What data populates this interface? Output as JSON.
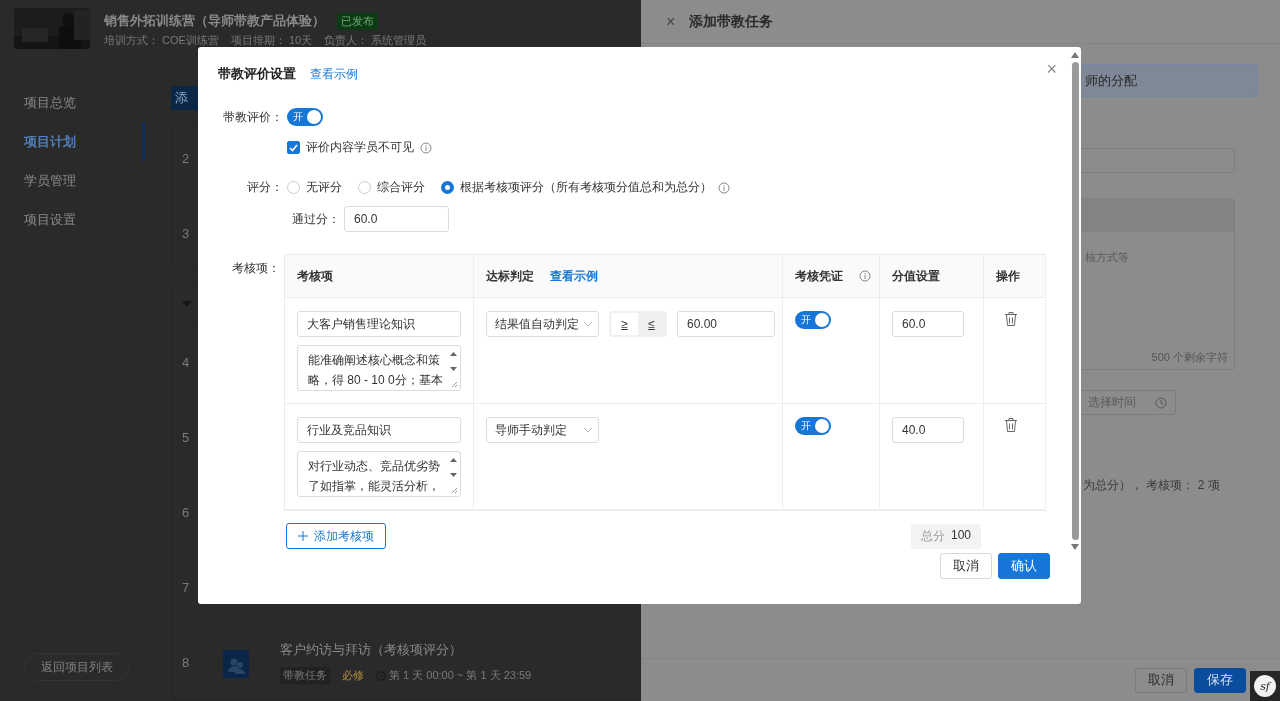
{
  "project": {
    "title": "销售外拓训练营（导师带教产品体验）",
    "status": "已发布",
    "meta": [
      {
        "label": "培训方式：",
        "value": "COE训练营"
      },
      {
        "label": "项目排期：",
        "value": "10天"
      },
      {
        "label": "负责人：",
        "value": "系统管理员"
      }
    ]
  },
  "sidebar": {
    "items": [
      {
        "label": "项目总览",
        "selected": false
      },
      {
        "label": "项目计划",
        "selected": true
      },
      {
        "label": "学员管理",
        "selected": false
      },
      {
        "label": "项目设置",
        "selected": false
      }
    ],
    "back_button": "返回项目列表"
  },
  "plan": {
    "add_button": "添",
    "first_group": [
      "2",
      "3"
    ],
    "second_group": {
      "expanded": true,
      "rows": [
        {
          "index": "4"
        },
        {
          "index": "5"
        },
        {
          "index": "6"
        },
        {
          "index": "7"
        },
        {
          "index": "8",
          "title": "客户约访与拜访（考核项评分）",
          "tag": "带教任务",
          "required": "必修",
          "time": "第 1 天 00:00 ~ 第 1 天 23:59"
        }
      ]
    }
  },
  "drawer": {
    "close": "×",
    "title": "添加带教任务",
    "banner": "师的分配",
    "placeholder": "核方式等",
    "counter": "500 个剩余字符",
    "time_placeholder": "选择时间",
    "summary": "为总分）， 考核项： 2 项",
    "buttons": [
      {
        "label": "取消",
        "primary": false
      },
      {
        "label": "保存",
        "primary": true
      }
    ],
    "badge": "sf"
  },
  "modal": {
    "title": "带教评价设置",
    "example_link": "查看示例",
    "close": "×",
    "evaluation": {
      "label": "带教评价：",
      "on": true,
      "text": "开"
    },
    "hidden_from_students": {
      "label": "评价内容学员不可见",
      "checked": true
    },
    "scoring": {
      "label": "评分：",
      "options": [
        {
          "label": "无评分",
          "selected": false
        },
        {
          "label": "综合评分",
          "selected": false
        },
        {
          "label": "根据考核项评分（所有考核项分值总和为总分）",
          "selected": true
        }
      ]
    },
    "pass_score": {
      "label": "通过分：",
      "value": "60.0"
    },
    "items_label": "考核项：",
    "table": {
      "columns": [
        "考核项",
        "达标判定",
        "考核凭证",
        "分值设置",
        "操作"
      ],
      "column_link": "查看示例",
      "rows": [
        {
          "name": "大客户销售理论知识",
          "description": "能准确阐述核心概念和策略，得 80 - 10 0分；基本",
          "judgement": "结果值自动判定",
          "operators": [
            {
              "label": "≥",
              "selected": true
            },
            {
              "label": "≤",
              "selected": false
            }
          ],
          "threshold": "60.00",
          "evidence": {
            "on": true,
            "text": "开"
          },
          "score": "60.0"
        },
        {
          "name": "行业及竞品知识",
          "description": "对行业动态、竞品优劣势了如指掌，能灵活分析，",
          "judgement": "导师手动判定",
          "evidence": {
            "on": true,
            "text": "开"
          },
          "score": "40.0"
        }
      ]
    },
    "add_item": "添加考核项",
    "total_label": "总分",
    "total": "100",
    "buttons": [
      {
        "label": "取消",
        "primary": false
      },
      {
        "label": "确认",
        "primary": true
      }
    ]
  }
}
